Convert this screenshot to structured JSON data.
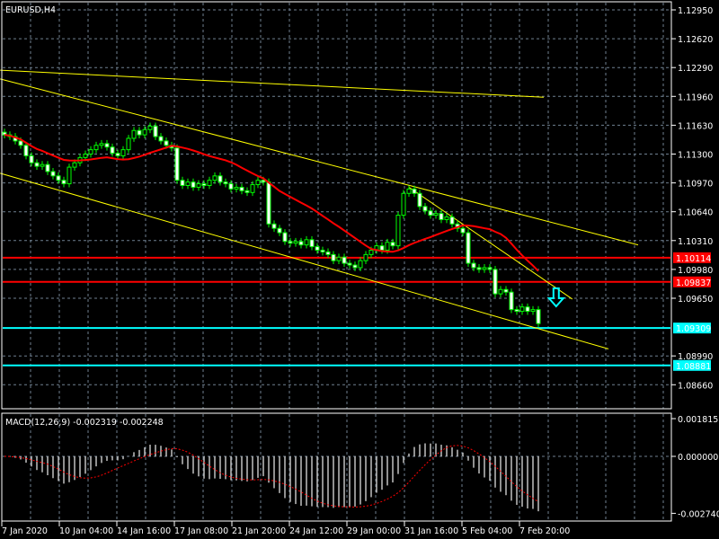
{
  "window": {
    "symbol_title": "EURUSD,H4"
  },
  "colors": {
    "background": "#000000",
    "grid": "#6f8091",
    "bull": "#00ff00",
    "bear_body": "#ffffff",
    "ma": "#ff0000",
    "trendline": "#ffff00",
    "resistance": "#ff0000",
    "support": "#00ffff",
    "macd_hist": "#c0c0c0",
    "macd_signal": "#ff0000",
    "arrow": "#00ffff"
  },
  "chart_data": [
    {
      "type": "candlestick",
      "title": "EURUSD,H4",
      "ylim": [
        1.0845,
        1.1307
      ],
      "y_ticks": [
        "1.12950",
        "1.12620",
        "1.12290",
        "1.11960",
        "1.11630",
        "1.11300",
        "1.10970",
        "1.10640",
        "1.10310",
        "1.09980",
        "1.09650",
        "1.08990",
        "1.08660"
      ],
      "x_tick_labels": [
        "7 Jan 2020",
        "10 Jan 04:00",
        "14 Jan 16:00",
        "17 Jan 08:00",
        "21 Jan 20:00",
        "24 Jan 12:00",
        "29 Jan 00:00",
        "31 Jan 16:00",
        "5 Feb 04:00",
        "7 Feb 20:00"
      ],
      "grid": true,
      "closes": [
        1.1152,
        1.115,
        1.1145,
        1.114,
        1.1128,
        1.112,
        1.1116,
        1.1118,
        1.111,
        1.1105,
        1.11,
        1.1096,
        1.1115,
        1.112,
        1.1126,
        1.113,
        1.1135,
        1.114,
        1.1142,
        1.1138,
        1.1131,
        1.1128,
        1.1135,
        1.1148,
        1.1157,
        1.1152,
        1.1158,
        1.1162,
        1.115,
        1.1145,
        1.114,
        1.1137,
        1.11,
        1.1094,
        1.1098,
        1.1092,
        1.1096,
        1.1094,
        1.11,
        1.1105,
        1.1098,
        1.1096,
        1.109,
        1.1092,
        1.1088,
        1.1086,
        1.1095,
        1.11,
        1.1098,
        1.105,
        1.1045,
        1.104,
        1.103,
        1.1028,
        1.103,
        1.1026,
        1.1032,
        1.1024,
        1.102,
        1.1018,
        1.1015,
        1.1008,
        1.1012,
        1.1005,
        1.1003,
        1.1,
        1.1008,
        1.1015,
        1.102,
        1.1025,
        1.102,
        1.1029,
        1.1025,
        1.106,
        1.1085,
        1.109,
        1.1085,
        1.107,
        1.1065,
        1.106,
        1.1062,
        1.1055,
        1.1058,
        1.105,
        1.1045,
        1.104,
        1.1005,
        1.1,
        1.0998,
        1.1,
        1.0998,
        1.097,
        1.0975,
        1.0972,
        1.0952,
        1.095,
        1.0955,
        1.095,
        1.0952,
        1.0936
      ],
      "moving_average": {
        "period": 20
      },
      "horizontal_levels": [
        {
          "price": "1.10114",
          "kind": "resistance"
        },
        {
          "price": "1.09837",
          "kind": "resistance"
        },
        {
          "price": "1.09309",
          "kind": "support"
        },
        {
          "price": "1.08881",
          "kind": "support"
        }
      ],
      "trendlines": [
        {
          "from": [
            -0.8,
            1.1226
          ],
          "to": [
            100,
            1.1195
          ]
        },
        {
          "from": [
            -0.8,
            1.1216
          ],
          "to": [
            117.5,
            1.1026
          ]
        },
        {
          "from": [
            -0.8,
            1.1108
          ],
          "to": [
            112,
            1.0907
          ]
        },
        {
          "from": [
            75,
            1.1092
          ],
          "to": [
            105.3,
            1.0964
          ]
        }
      ],
      "signal_arrow": {
        "direction": "down",
        "bar": 102.3,
        "price": 1.0965
      }
    },
    {
      "type": "bar",
      "title": "MACD(12,26,9) -0.002319 -0.002248",
      "label": "MACD(12,26,9)",
      "main_value": "-0.002319",
      "signal_value": "-0.002248",
      "params": {
        "fast": 12,
        "slow": 26,
        "signal": 9
      },
      "y_ticks": [
        "0.001815",
        "0.000000",
        "-0.002740"
      ],
      "ylim": [
        -0.00274,
        0.001815
      ]
    }
  ]
}
